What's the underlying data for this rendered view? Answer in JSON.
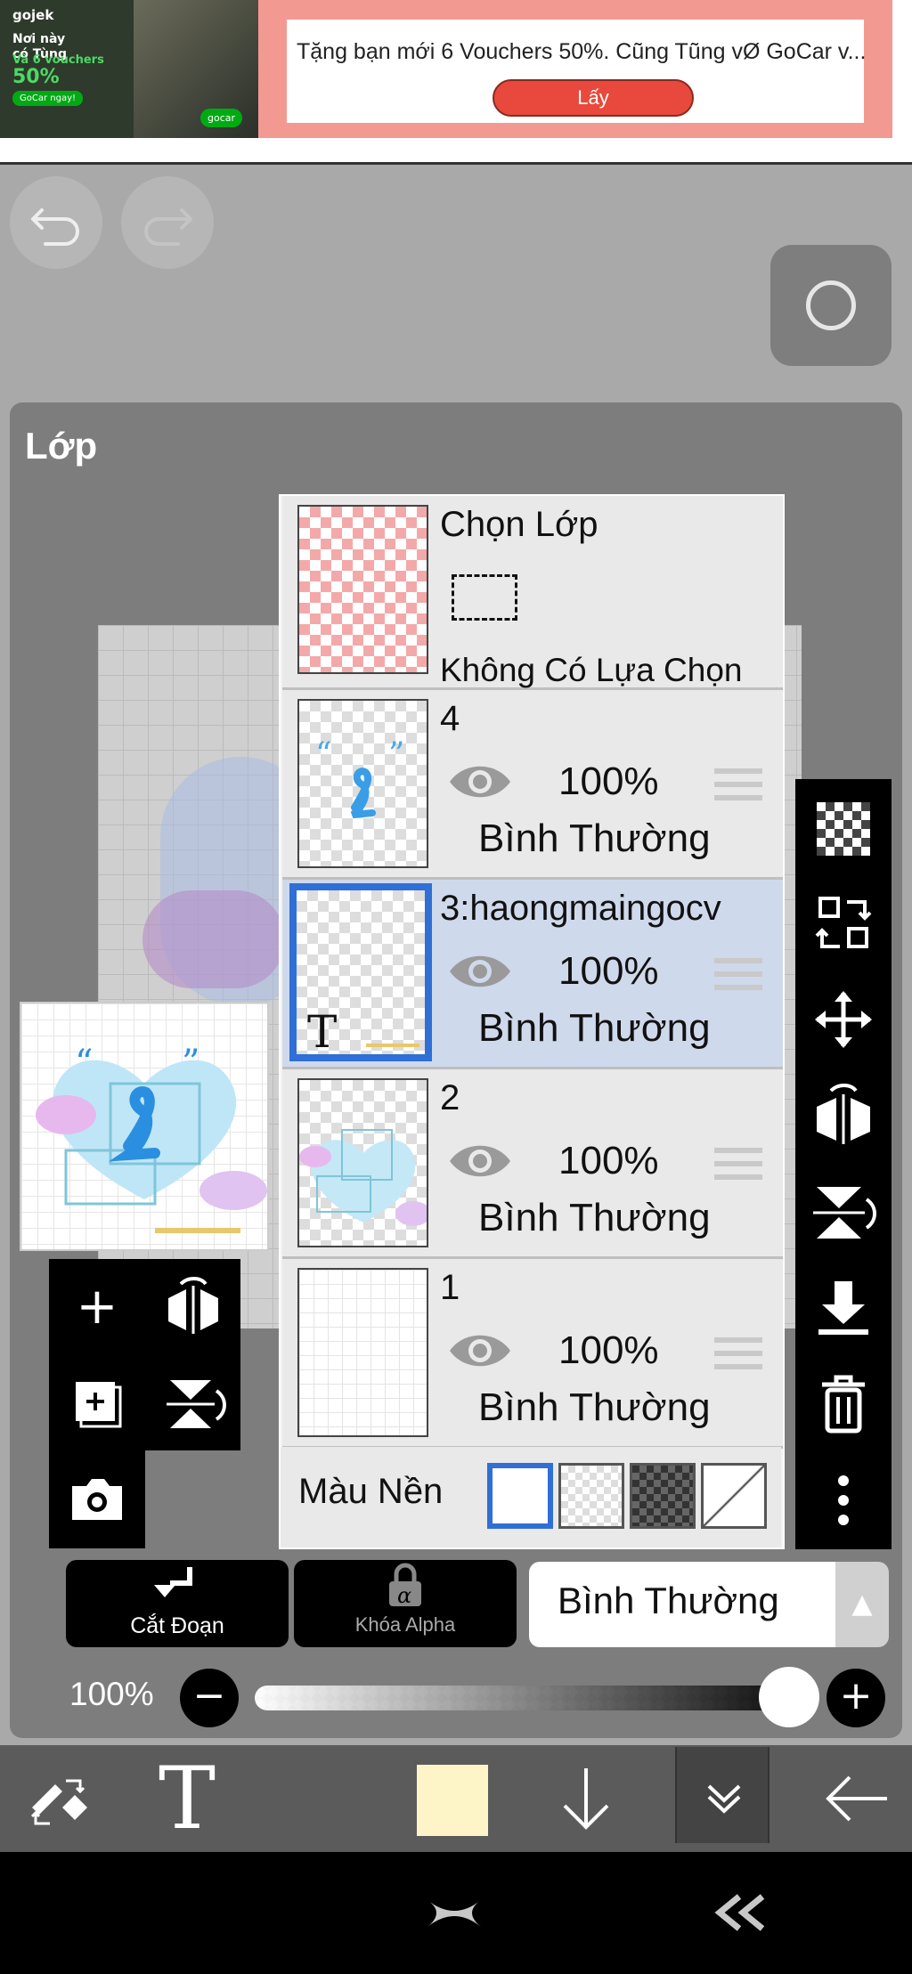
{
  "ad": {
    "brand": "gojek",
    "promo_line1": "Nơi này",
    "promo_line2": "có Tùng",
    "promo_line3": "Và 6 vouchers",
    "promo_big": "50%",
    "promo_cta": "GoCar ngay!",
    "promo_logo": "gocar",
    "headline": "Tặng bạn mới 6 Vouchers 50%. Cũng Tũng vØ GoCar v...",
    "button": "Lấy"
  },
  "panel": {
    "title": "Lớp"
  },
  "selection_layer": {
    "title": "Chọn Lớp",
    "status": "Không Có Lựa Chọn"
  },
  "layers": [
    {
      "name": "4",
      "opacity": "100%",
      "blend": "Bình Thường"
    },
    {
      "name": "3:haongmaingocv",
      "opacity": "100%",
      "blend": "Bình Thường",
      "type_glyph": "T",
      "selected": true
    },
    {
      "name": "2",
      "opacity": "100%",
      "blend": "Bình Thường"
    },
    {
      "name": "1",
      "opacity": "100%",
      "blend": "Bình Thường"
    }
  ],
  "background_row": {
    "label": "Màu Nền"
  },
  "controls": {
    "clip_label": "Cắt Đoạn",
    "alpha_lock_label": "Khóa Alpha",
    "blend_mode": "Bình Thường",
    "opacity_label": "100%",
    "opacity_value": 1.0
  },
  "colors": {
    "accent": "#2f6fd6",
    "current_color": "#fdf4c8",
    "selected_layer_bg": "#cfd9ec"
  },
  "icons": {
    "undo": "undo-icon",
    "redo": "redo-icon",
    "brush": "brush-circle-icon",
    "eye": "eye-icon",
    "trash": "trash-icon"
  }
}
